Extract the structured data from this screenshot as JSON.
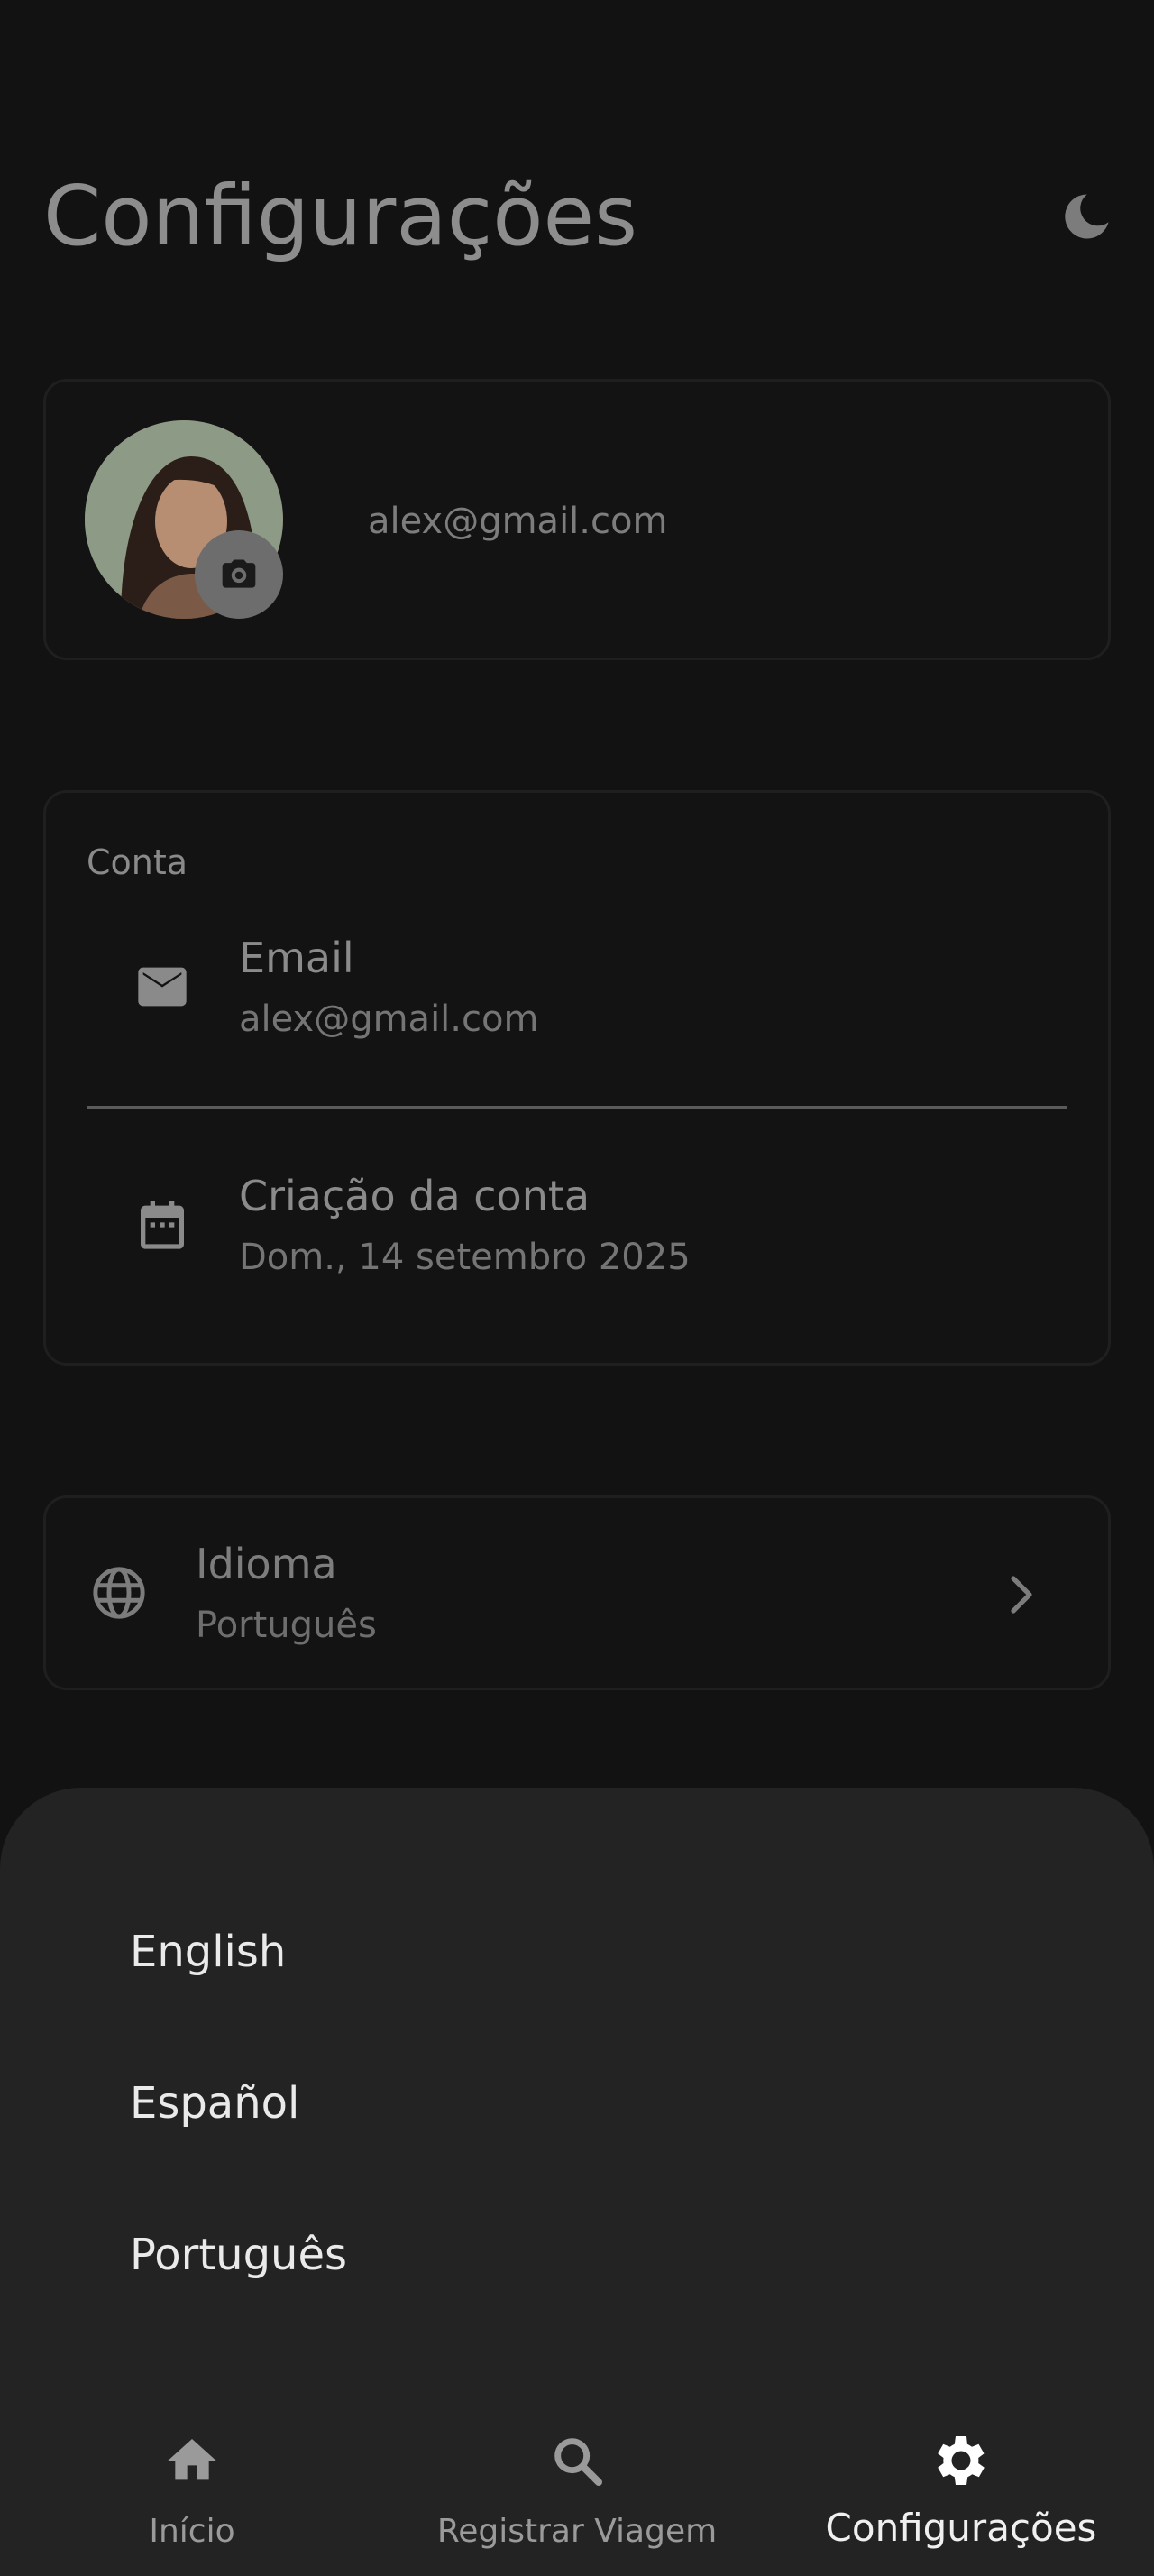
{
  "header": {
    "title": "Configurações",
    "theme_icon": "moon-icon"
  },
  "profile": {
    "email": "alex@gmail.com",
    "avatar_icon": "avatar",
    "camera_icon": "camera-icon"
  },
  "account": {
    "section_label": "Conta",
    "email_row": {
      "icon": "mail-icon",
      "title": "Email",
      "value": "alex@gmail.com"
    },
    "created_row": {
      "icon": "calendar-icon",
      "title": "Criação da conta",
      "value": "Dom., 14 setembro 2025"
    }
  },
  "language": {
    "icon": "globe-icon",
    "title": "Idioma",
    "value": "Português",
    "chevron_icon": "chevron-right-icon"
  },
  "language_sheet": {
    "options": [
      "English",
      "Español",
      "Português"
    ]
  },
  "bottom_nav": {
    "items": [
      {
        "label": "Início",
        "icon": "home-icon",
        "active": false
      },
      {
        "label": "Registrar Viagem",
        "icon": "search-icon",
        "active": false
      },
      {
        "label": "Configurações",
        "icon": "gear-icon",
        "active": true
      }
    ]
  },
  "colors": {
    "background": "#121212",
    "sheet": "#232323",
    "active_nav": "#ffffff"
  }
}
